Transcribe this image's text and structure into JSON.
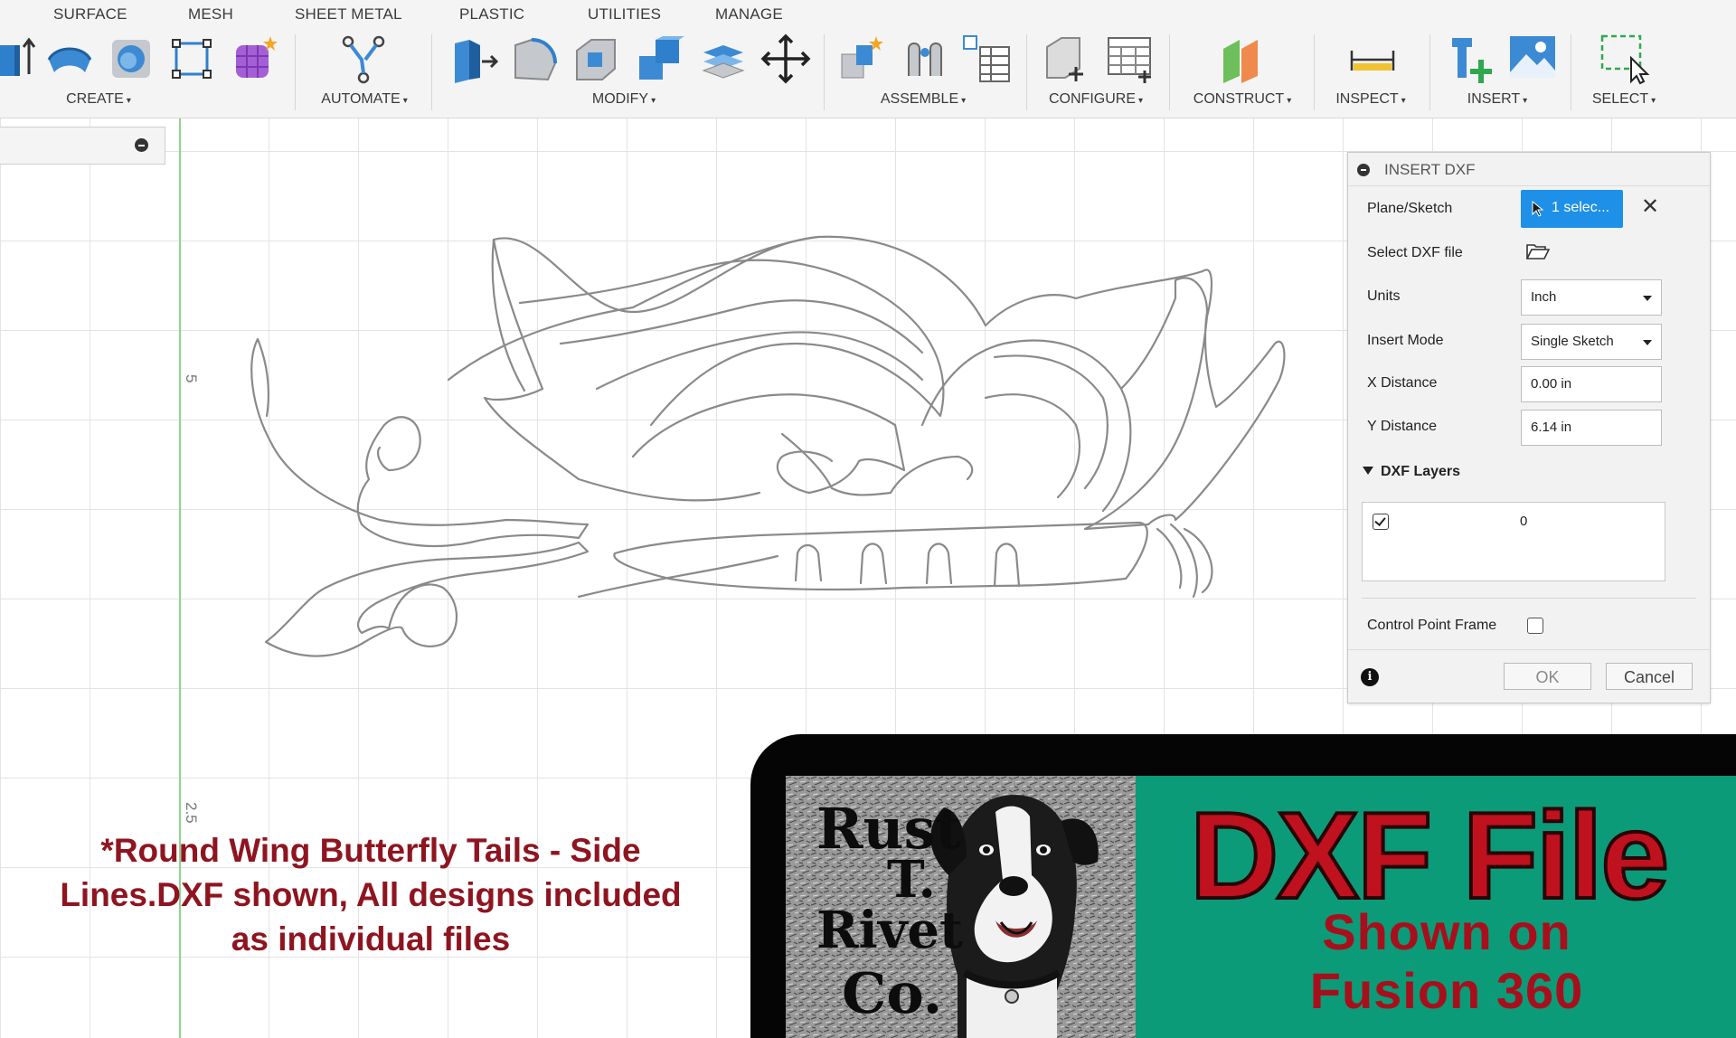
{
  "toolbar": {
    "tabs": [
      "SURFACE",
      "MESH",
      "SHEET METAL",
      "PLASTIC",
      "UTILITIES",
      "MANAGE"
    ],
    "groups": [
      "CREATE",
      "AUTOMATE",
      "MODIFY",
      "ASSEMBLE",
      "CONFIGURE",
      "CONSTRUCT",
      "INSPECT",
      "INSERT",
      "SELECT"
    ],
    "caret": "▾"
  },
  "canvas": {
    "axis_labels": [
      "5",
      "2.5"
    ],
    "sketch_name": "Round Wing Butterfly Tails - Side Lines"
  },
  "dialog": {
    "title": "INSERT DXF",
    "plane_sketch_label": "Plane/Sketch",
    "plane_sketch_value": "1 selec...",
    "clear_symbol": "✕",
    "select_file_label": "Select DXF file",
    "units_label": "Units",
    "units_value": "Inch",
    "insert_mode_label": "Insert Mode",
    "insert_mode_value": "Single Sketch",
    "x_distance_label": "X Distance",
    "x_distance_value": "0.00 in",
    "y_distance_label": "Y Distance",
    "y_distance_value": "6.14 in",
    "layers_header": "DXF Layers",
    "layers": [
      {
        "name": "0",
        "checked": true
      }
    ],
    "control_point_label": "Control Point Frame",
    "control_point_checked": false,
    "info_symbol": "i",
    "ok_label": "OK",
    "cancel_label": "Cancel"
  },
  "caption": {
    "line1": "*Round Wing Butterfly Tails - Side",
    "line2": "Lines.DXF shown, All designs included",
    "line3": "as individual files"
  },
  "banner": {
    "logo_line1": "Rust",
    "logo_line2": "T.",
    "logo_line3": "Rivet",
    "logo_line4": "Co.",
    "title": "DXF File",
    "subtitle1": "Shown on",
    "subtitle2": "Fusion 360"
  },
  "colors": {
    "accent_blue": "#1e90e8",
    "caption_red": "#8e1520",
    "banner_teal": "#0b9b78",
    "banner_red": "#c0111f",
    "axis_green": "#8fd48f"
  }
}
